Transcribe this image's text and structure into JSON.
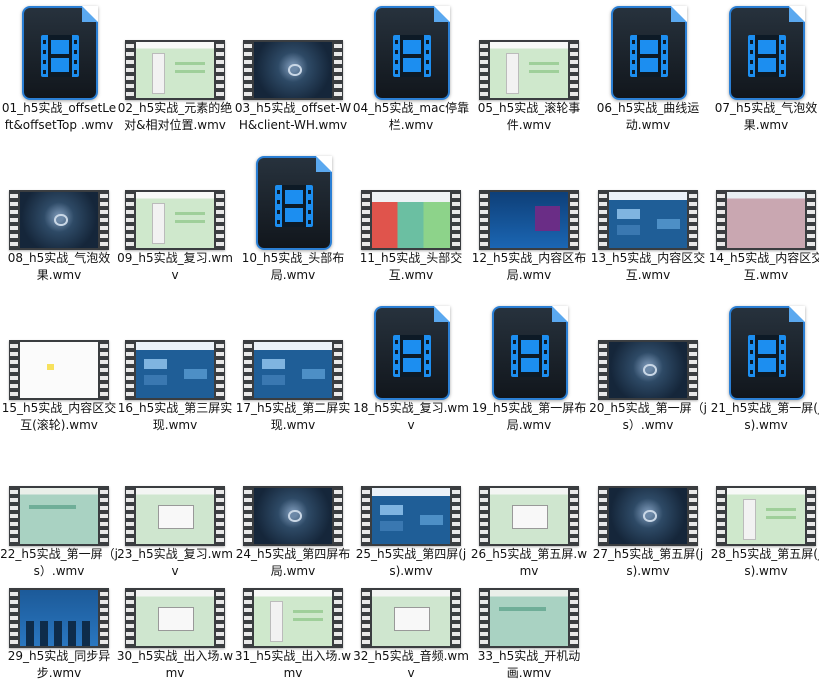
{
  "files": [
    {
      "name": "01_h5实战_offsetLeft&offsetTop .wmv",
      "thumb": "icon"
    },
    {
      "name": "02_h5实战_元素的绝对&相对位置.wmv",
      "thumb": "green"
    },
    {
      "name": "03_h5实战_offset-WH&client-WH.wmv",
      "thumb": "dark"
    },
    {
      "name": "04_h5实战_mac停靠栏.wmv",
      "thumb": "icon"
    },
    {
      "name": "05_h5实战_滚轮事件.wmv",
      "thumb": "green"
    },
    {
      "name": "06_h5实战_曲线运动.wmv",
      "thumb": "icon"
    },
    {
      "name": "07_h5实战_气泡效果.wmv",
      "thumb": "icon"
    },
    {
      "name": "08_h5实战_气泡效果.wmv",
      "thumb": "dark"
    },
    {
      "name": "09_h5实战_复习.wmv",
      "thumb": "green"
    },
    {
      "name": "10_h5实战_头部布局.wmv",
      "thumb": "icon"
    },
    {
      "name": "11_h5实战_头部交互.wmv",
      "thumb": "color"
    },
    {
      "name": "12_h5实战_内容区布局.wmv",
      "thumb": "space"
    },
    {
      "name": "13_h5实战_内容区交互.wmv",
      "thumb": "blue"
    },
    {
      "name": "14_h5实战_内容区交互.wmv",
      "thumb": "pink"
    },
    {
      "name": "15_h5实战_内容区交互(滚轮).wmv",
      "thumb": "white"
    },
    {
      "name": "16_h5实战_第三屏实现.wmv",
      "thumb": "blue"
    },
    {
      "name": "17_h5实战_第二屏实现.wmv",
      "thumb": "blue"
    },
    {
      "name": "18_h5实战_复习.wmv",
      "thumb": "icon"
    },
    {
      "name": "19_h5实战_第一屏布局.wmv",
      "thumb": "icon"
    },
    {
      "name": "20_h5实战_第一屏（js）.wmv",
      "thumb": "dark"
    },
    {
      "name": "21_h5实战_第一屏(js).wmv",
      "thumb": "icon"
    },
    {
      "name": "22_h5实战_第一屏（js）.wmv",
      "thumb": "mint"
    },
    {
      "name": "23_h5实战_复习.wmv",
      "thumb": "dialog"
    },
    {
      "name": "24_h5实战_第四屏布局.wmv",
      "thumb": "dark"
    },
    {
      "name": "25_h5实战_第四屏(js).wmv",
      "thumb": "blue"
    },
    {
      "name": "26_h5实战_第五屏.wmv",
      "thumb": "dialog"
    },
    {
      "name": "27_h5实战_第五屏(js).wmv",
      "thumb": "dark"
    },
    {
      "name": "28_h5实战_第五屏(js).wmv",
      "thumb": "green"
    },
    {
      "name": "29_h5实战_同步异步.wmv",
      "thumb": "people"
    },
    {
      "name": "30_h5实战_出入场.wmv",
      "thumb": "dialog"
    },
    {
      "name": "31_h5实战_出入场.wmv",
      "thumb": "green"
    },
    {
      "name": "32_h5实战_音频.wmv",
      "thumb": "dialog"
    },
    {
      "name": "33_h5实战_开机动画.wmv",
      "thumb": "mint"
    }
  ]
}
